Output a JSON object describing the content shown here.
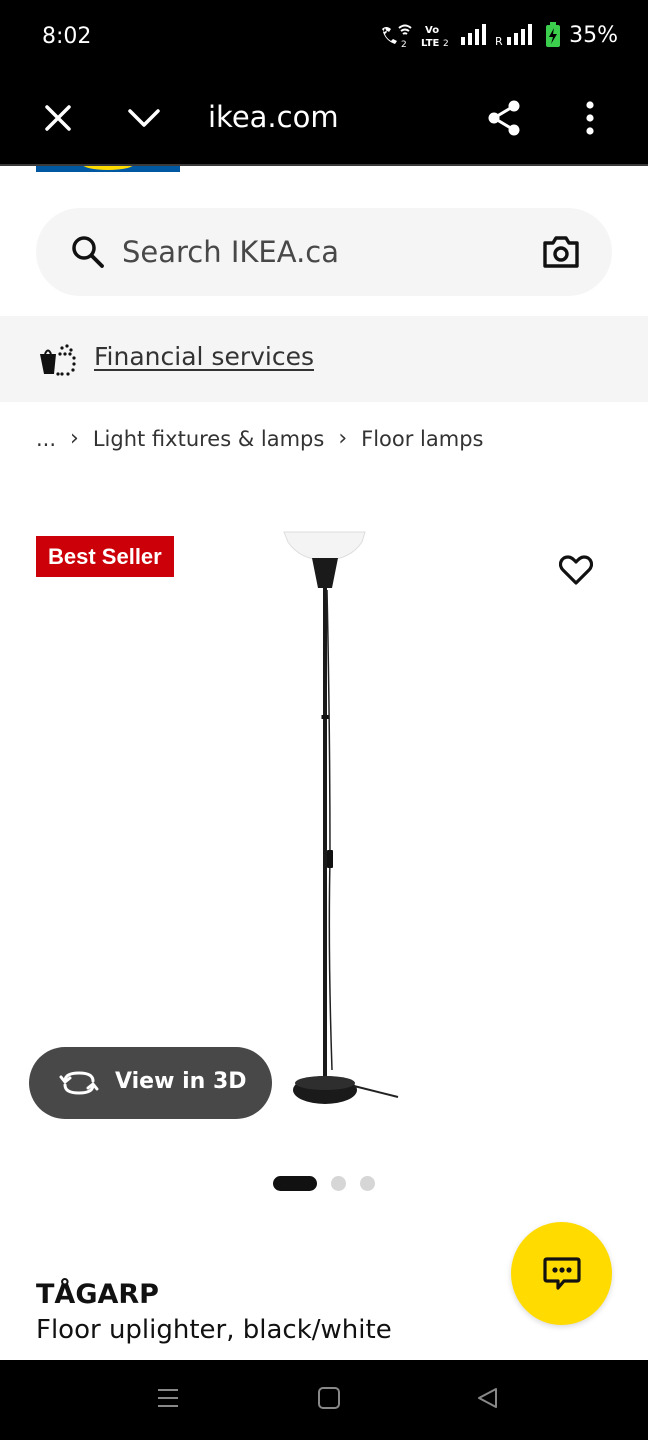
{
  "status_bar": {
    "time": "8:02",
    "battery": "35%",
    "icons": [
      "wifi-call-icon",
      "volte-icon",
      "signal-icon",
      "roaming-signal-icon",
      "battery-charging-icon"
    ]
  },
  "browser": {
    "url": "ikea.com",
    "icons": [
      "close-icon",
      "chevron-down-icon",
      "share-icon",
      "more-vert-icon"
    ]
  },
  "search": {
    "placeholder": "Search IKEA.ca"
  },
  "banner": {
    "link_text": "Financial services"
  },
  "breadcrumb": {
    "items": [
      "...",
      "Light fixtures & lamps",
      "Floor lamps"
    ]
  },
  "product": {
    "badge": "Best Seller",
    "view_3d_label": "View in 3D",
    "name": "TÅGARP",
    "description": "Floor uplighter, black/white",
    "image_count": 3,
    "active_image": 1
  },
  "colors": {
    "badge": "#cc0008",
    "chat_fab": "#ffdb00",
    "view3d_bg": "#484848",
    "search_bg": "#f5f5f5"
  }
}
